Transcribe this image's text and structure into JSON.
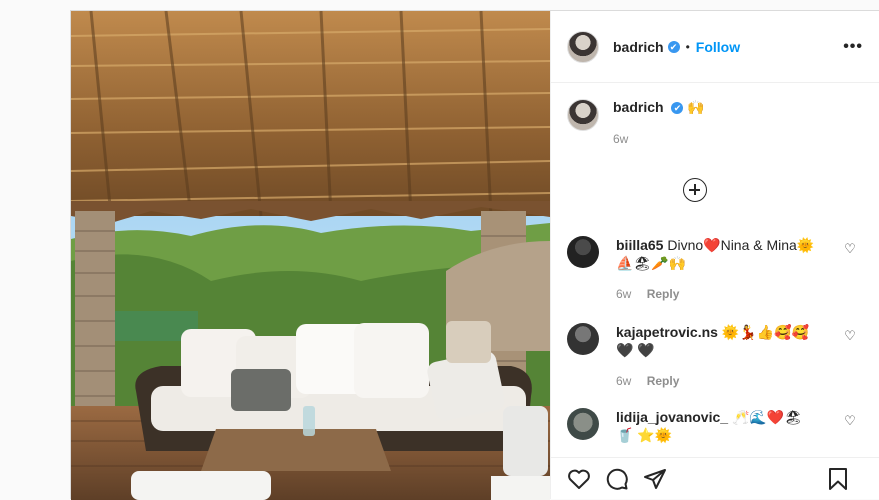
{
  "post": {
    "username": "badrich",
    "verified_mark": "✔",
    "separator": "•",
    "follow_label": "Follow",
    "more_label": "•••",
    "caption": {
      "username": "badrich",
      "text": "🙌",
      "time": "6w"
    },
    "comments": [
      {
        "username": "biilla65",
        "text": "Divno❤️Nina & Mina🌞 ⛵🏖🥕🙌",
        "time": "6w",
        "reply": "Reply"
      },
      {
        "username": "kajapetrovic.ns",
        "text": "🌞💃👍🥰🥰🖤 🖤",
        "time": "6w",
        "reply": "Reply"
      },
      {
        "username": "lidija_jovanovic_",
        "text": "🥂🌊❤️🏖🥤 ⭐🌞",
        "time": "",
        "reply": ""
      }
    ]
  },
  "icons": {
    "like": "heart-icon",
    "comment": "comment-icon",
    "share": "share-icon",
    "save": "bookmark-icon",
    "load_more": "add-circle-icon"
  }
}
